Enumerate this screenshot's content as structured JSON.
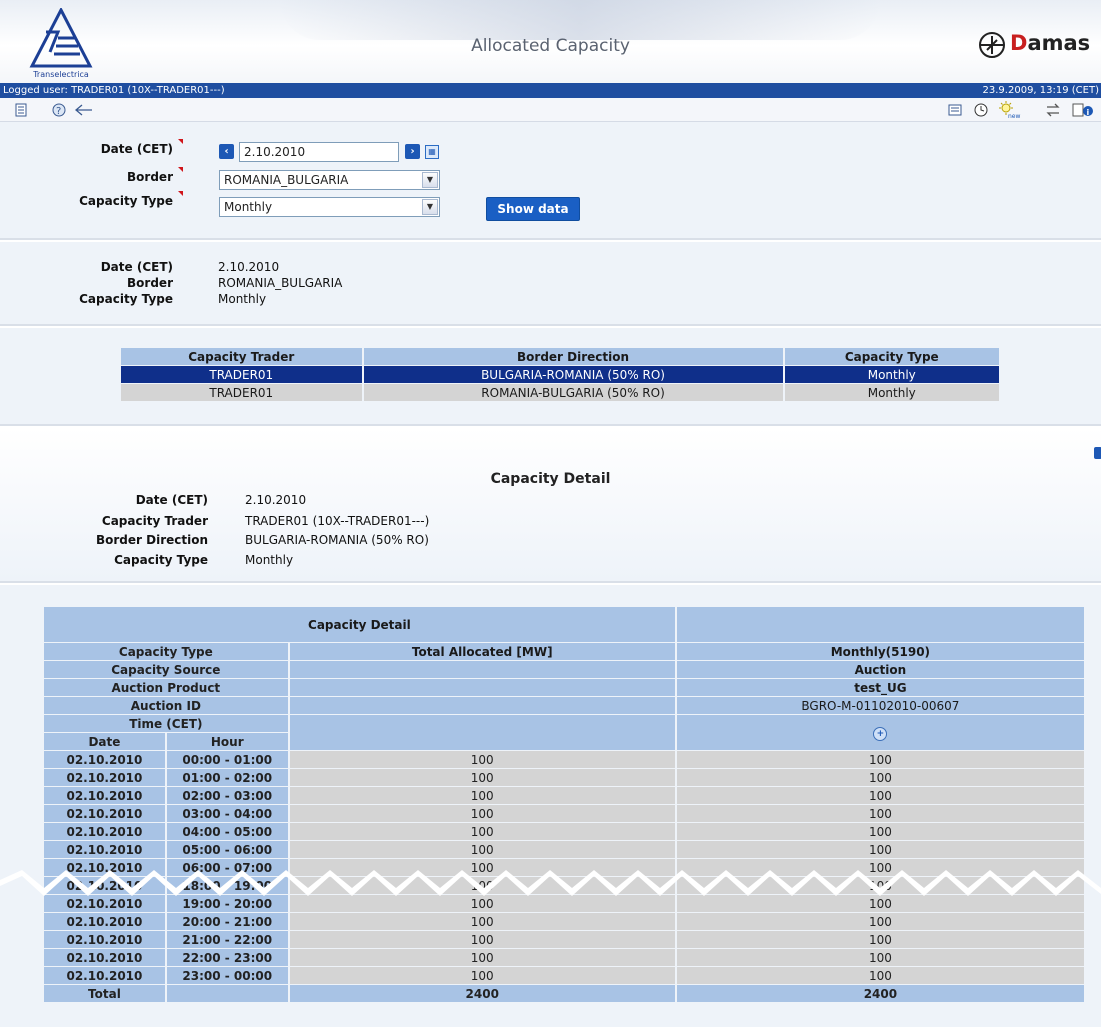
{
  "header": {
    "logo_text": "Transelectrica",
    "title": "Allocated Capacity",
    "brand": "Damas",
    "brand_first": "D",
    "brand_rest": "amas"
  },
  "userbar": {
    "user": "Logged user: TRADER01 (10X--TRADER01---)",
    "datetime": "23.9.2009, 13:19  (CET)"
  },
  "toolbar": {
    "left_icons": [
      "document-icon",
      "help-icon",
      "back-arrow-icon"
    ],
    "right_icons": [
      "list-icon",
      "clock-icon",
      "new-sun-icon",
      "transfer-icon",
      "info-doc-icon"
    ]
  },
  "form": {
    "date_label": "Date (CET)",
    "date_value": "2.10.2010",
    "border_label": "Border",
    "border_value": "ROMANIA_BULGARIA",
    "capacity_type_label": "Capacity Type",
    "capacity_type_value": "Monthly",
    "show_button": "Show data"
  },
  "summary": {
    "date_label": "Date (CET)",
    "date_value": "2.10.2010",
    "border_label": "Border",
    "border_value": "ROMANIA_BULGARIA",
    "type_label": "Capacity Type",
    "type_value": "Monthly"
  },
  "traders_table": {
    "headers": [
      "Capacity Trader",
      "Border Direction",
      "Capacity Type"
    ],
    "rows": [
      [
        "TRADER01",
        "BULGARIA-ROMANIA (50% RO)",
        "Monthly"
      ],
      [
        "TRADER01",
        "ROMANIA-BULGARIA (50% RO)",
        "Monthly"
      ]
    ]
  },
  "detail": {
    "title": "Capacity Detail",
    "date_label": "Date (CET)",
    "date_value": "2.10.2010",
    "trader_label": "Capacity Trader",
    "trader_value": "TRADER01 (10X--TRADER01---)",
    "direction_label": "Border Direction",
    "direction_value": "BULGARIA-ROMANIA (50% RO)",
    "type_label": "Capacity Type",
    "type_value": "Monthly"
  },
  "detail_table": {
    "title": "Capacity Detail",
    "capacity_type_label": "Capacity Type",
    "total_allocated_label": "Total Allocated [MW]",
    "monthly_label": "Monthly(5190)",
    "capacity_source_label": "Capacity Source",
    "capacity_source_value": "Auction",
    "auction_product_label": "Auction Product",
    "auction_product_value": "test_UG",
    "auction_id_label": "Auction ID",
    "auction_id_value": "BGRO-M-01102010-00607",
    "time_label": "Time (CET)",
    "date_col": "Date",
    "hour_col": "Hour",
    "rows": [
      {
        "date": "02.10.2010",
        "hour": "00:00 - 01:00",
        "total": "100",
        "monthly": "100"
      },
      {
        "date": "02.10.2010",
        "hour": "01:00 - 02:00",
        "total": "100",
        "monthly": "100"
      },
      {
        "date": "02.10.2010",
        "hour": "02:00 - 03:00",
        "total": "100",
        "monthly": "100"
      },
      {
        "date": "02.10.2010",
        "hour": "03:00 - 04:00",
        "total": "100",
        "monthly": "100"
      },
      {
        "date": "02.10.2010",
        "hour": "04:00 - 05:00",
        "total": "100",
        "monthly": "100"
      },
      {
        "date": "02.10.2010",
        "hour": "05:00 - 06:00",
        "total": "100",
        "monthly": "100"
      },
      {
        "date": "02.10.2010",
        "hour": "06:00 - 07:00",
        "total": "100",
        "monthly": "100"
      },
      {
        "date": "02.10.2010",
        "hour": "18:00 - 19:00",
        "total": "100",
        "monthly": "100"
      },
      {
        "date": "02.10.2010",
        "hour": "19:00 - 20:00",
        "total": "100",
        "monthly": "100"
      },
      {
        "date": "02.10.2010",
        "hour": "20:00 - 21:00",
        "total": "100",
        "monthly": "100"
      },
      {
        "date": "02.10.2010",
        "hour": "21:00 - 22:00",
        "total": "100",
        "monthly": "100"
      },
      {
        "date": "02.10.2010",
        "hour": "22:00 - 23:00",
        "total": "100",
        "monthly": "100"
      },
      {
        "date": "02.10.2010",
        "hour": "23:00 - 00:00",
        "total": "100",
        "monthly": "100"
      }
    ],
    "total_label": "Total",
    "total_value": "2400",
    "total_monthly": "2400"
  }
}
